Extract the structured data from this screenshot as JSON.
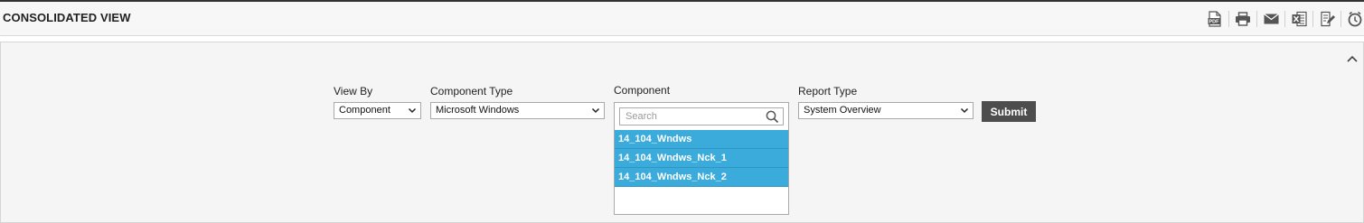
{
  "header": {
    "title": "CONSOLIDATED VIEW",
    "tools": [
      {
        "icon": "pdf-icon",
        "label": "PDF"
      },
      {
        "icon": "print-icon"
      },
      {
        "icon": "email-icon"
      },
      {
        "icon": "excel-icon"
      },
      {
        "icon": "edit-report-icon"
      },
      {
        "icon": "schedule-icon"
      }
    ]
  },
  "filters": {
    "view_by": {
      "label": "View By",
      "value": "Component"
    },
    "component_type": {
      "label": "Component Type",
      "value": "Microsoft Windows"
    },
    "component": {
      "label": "Component",
      "search_placeholder": "Search",
      "options": [
        "14_104_Wndws",
        "14_104_Wndws_Nck_1",
        "14_104_Wndws_Nck_2"
      ]
    },
    "report_type": {
      "label": "Report Type",
      "value": "System Overview"
    },
    "submit_label": "Submit"
  },
  "colors": {
    "selected_option": "#3aabda",
    "submit_button": "#4d4d4d"
  }
}
